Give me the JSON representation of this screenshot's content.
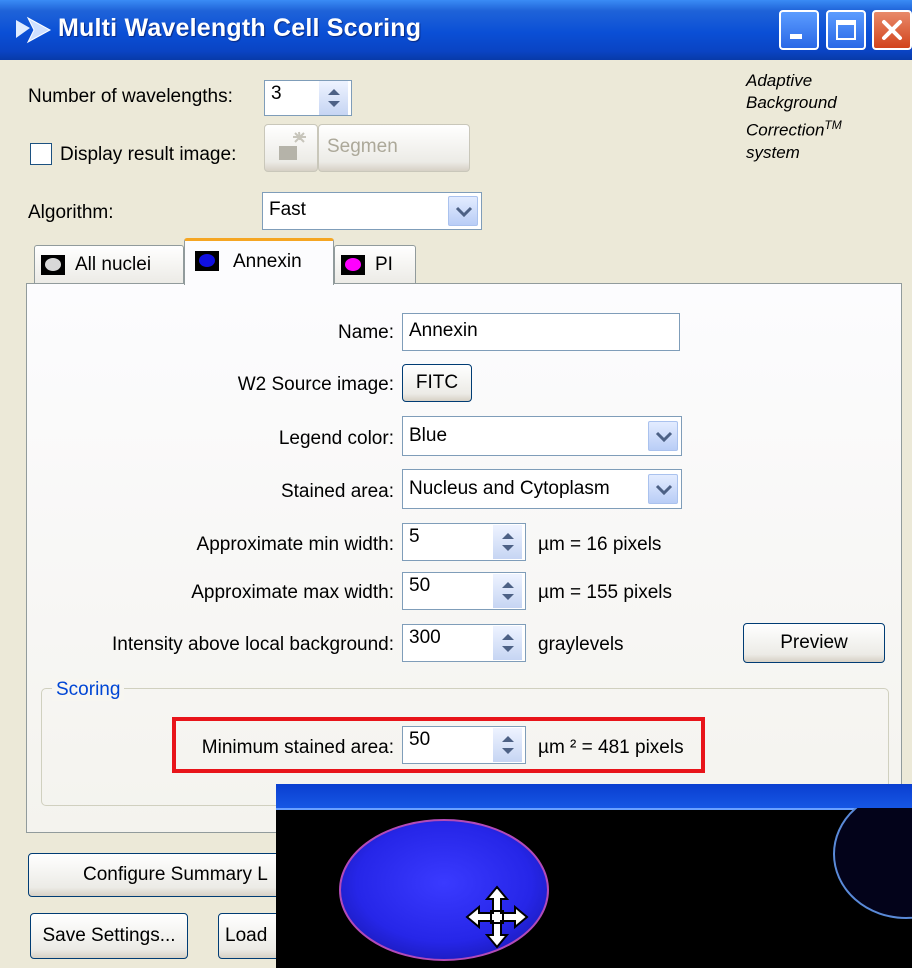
{
  "window": {
    "title": "Multi Wavelength Cell Scoring",
    "icon": "scoring-app-icon"
  },
  "branding": {
    "line1": "Adaptive",
    "line2": "Background",
    "line3": "Correction",
    "tm": "TM",
    "line4": "system"
  },
  "top": {
    "num_wavelengths_label": "Number of wavelengths:",
    "num_wavelengths_value": "3",
    "display_result_label": "Display result image:",
    "display_result_checked": false,
    "segmen_label": "Segmen",
    "algorithm_label": "Algorithm:",
    "algorithm_value": "Fast"
  },
  "tabs": [
    {
      "label": "All nuclei",
      "swatch": "#d8d8d8",
      "active": false
    },
    {
      "label": "Annexin",
      "swatch": "#1010e0",
      "active": true
    },
    {
      "label": "PI",
      "swatch": "#ff00ff",
      "active": false
    }
  ],
  "form": {
    "name_label": "Name:",
    "name_value": "Annexin",
    "source_label": "W2 Source image:",
    "source_value": "FITC",
    "legend_label": "Legend color:",
    "legend_value": "Blue",
    "stained_label": "Stained area:",
    "stained_value": "Nucleus and Cytoplasm",
    "min_width_label": "Approximate min width:",
    "min_width_value": "5",
    "min_width_unit": "µm = 16 pixels",
    "max_width_label": "Approximate max width:",
    "max_width_value": "50",
    "max_width_unit": "µm = 155 pixels",
    "intensity_label": "Intensity above local background:",
    "intensity_value": "300",
    "intensity_unit": "graylevels",
    "preview_label": "Preview"
  },
  "scoring": {
    "title": "Scoring",
    "min_area_label": "Minimum stained area:",
    "min_area_value": "50",
    "min_area_unit": "µm ² = 481 pixels"
  },
  "bottom": {
    "configure_label": "Configure Summary L",
    "save_label": "Save Settings...",
    "load_label": "Load"
  },
  "colors": {
    "highlight": "#e8141a",
    "titlebar": "#0a4fd6",
    "cell_fill": "#2a2af0"
  },
  "overlay": {
    "cursor_icon": "move-cursor-icon"
  }
}
